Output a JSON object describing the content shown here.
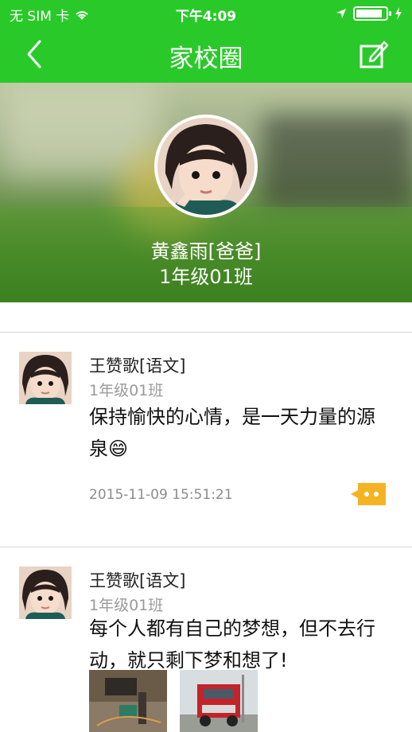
{
  "status_bar": {
    "carrier": "无 SIM 卡",
    "time": "下午4:09",
    "battery_level": 0.9
  },
  "nav": {
    "title": "家校圈",
    "back_icon": "chevron-left-icon",
    "edit_icon": "compose-icon"
  },
  "profile": {
    "name": "黄鑫雨[爸爸]",
    "class": "1年级01班"
  },
  "posts": [
    {
      "author": "王赞歌[语文]",
      "class": "1年级01班",
      "content": "保持愉快的心情，是一天力量的源泉",
      "emoji": "😄",
      "time": "2015-11-09 15:51:21"
    },
    {
      "author": "王赞歌[语文]",
      "class": "1年级01班",
      "content": "每个人都有自己的梦想，但不去行动，就只剩下梦和想了!"
    }
  ],
  "colors": {
    "brand": "#2ac92a",
    "comment_badge": "#f5b324"
  }
}
